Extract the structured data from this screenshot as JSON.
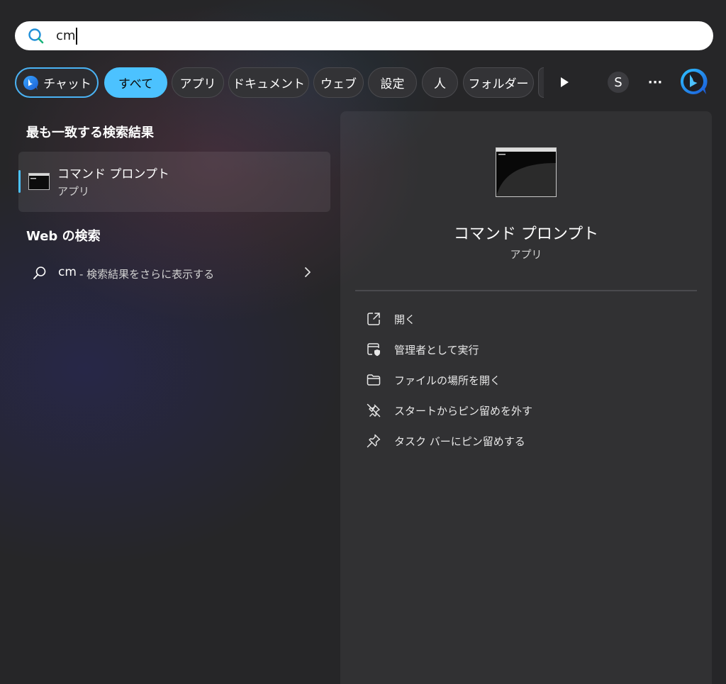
{
  "search": {
    "query": "cm"
  },
  "filters": {
    "chat": "チャット",
    "all": "すべて",
    "apps": "アプリ",
    "documents": "ドキュメント",
    "web": "ウェブ",
    "settings": "設定",
    "people": "人",
    "folders": "フォルダー",
    "avatar_initial": "S",
    "more": "···"
  },
  "best_match": {
    "heading": "最も一致する検索結果",
    "name": "コマンド プロンプト",
    "type": "アプリ"
  },
  "web_search": {
    "heading": "Web の検索",
    "query": "cm",
    "more_text": "- 検索結果をさらに表示する"
  },
  "detail": {
    "name": "コマンド プロンプト",
    "type": "アプリ",
    "actions": [
      {
        "label": "開く",
        "icon": "open-external-icon"
      },
      {
        "label": "管理者として実行",
        "icon": "shield-admin-icon"
      },
      {
        "label": "ファイルの場所を開く",
        "icon": "folder-icon"
      },
      {
        "label": "スタートからピン留めを外す",
        "icon": "unpin-icon"
      },
      {
        "label": "タスク バーにピン留めする",
        "icon": "pin-icon"
      }
    ]
  },
  "colors": {
    "accent": "#4cc2ff",
    "chat_border": "#4ab3f4"
  }
}
